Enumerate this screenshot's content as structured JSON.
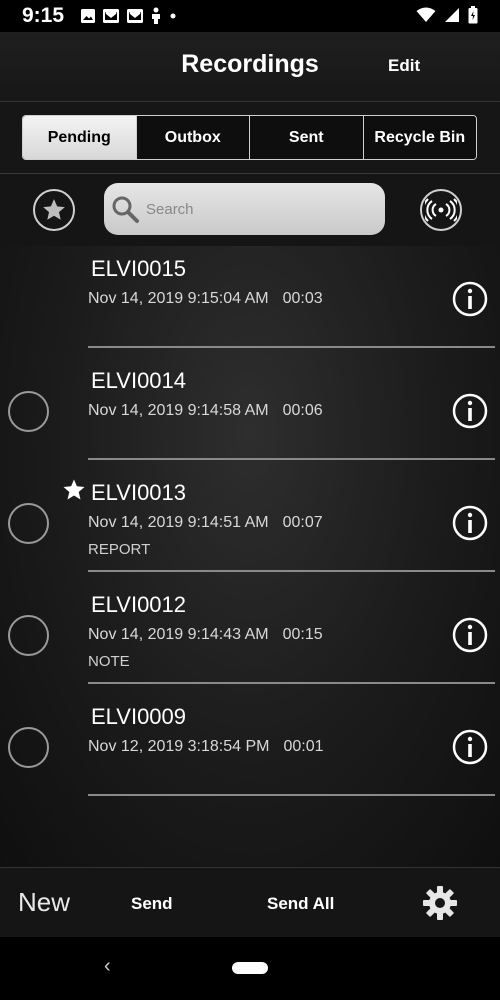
{
  "status_bar": {
    "time": "9:15",
    "left_icons": [
      "image-icon",
      "mail-icon",
      "mail-icon",
      "person-icon",
      "dot-icon"
    ],
    "right_icons": [
      "wifi-icon",
      "signal-icon",
      "battery-icon"
    ]
  },
  "header": {
    "title": "Recordings",
    "edit_label": "Edit"
  },
  "tabs": [
    {
      "label": "Pending",
      "active": true
    },
    {
      "label": "Outbox",
      "active": false
    },
    {
      "label": "Sent",
      "active": false
    },
    {
      "label": "Recycle Bin",
      "active": false
    }
  ],
  "search": {
    "placeholder": "Search"
  },
  "recordings": [
    {
      "name": "ELVI0015",
      "date": "Nov 14, 2019 9:15:04 AM",
      "duration": "00:03",
      "tag": "",
      "starred": false,
      "selectable": false
    },
    {
      "name": "ELVI0014",
      "date": "Nov 14, 2019 9:14:58 AM",
      "duration": "00:06",
      "tag": "",
      "starred": false,
      "selectable": true
    },
    {
      "name": "ELVI0013",
      "date": "Nov 14, 2019 9:14:51 AM",
      "duration": "00:07",
      "tag": "REPORT",
      "starred": true,
      "selectable": true
    },
    {
      "name": "ELVI0012",
      "date": "Nov 14, 2019 9:14:43 AM",
      "duration": "00:15",
      "tag": "NOTE",
      "starred": false,
      "selectable": true
    },
    {
      "name": "ELVI0009",
      "date": "Nov 12, 2019 3:18:54 PM",
      "duration": "00:01",
      "tag": "",
      "starred": false,
      "selectable": true
    }
  ],
  "bottom_bar": {
    "new_label": "New",
    "send_label": "Send",
    "send_all_label": "Send All"
  },
  "nav_bar": {
    "back_icon": "back-icon",
    "home_icon": "home-pill-icon"
  },
  "colors": {
    "background": "#000000",
    "text": "#ffffff",
    "tab_active_bg": "#e6e6e6",
    "search_bg": "#d6d6d6"
  }
}
